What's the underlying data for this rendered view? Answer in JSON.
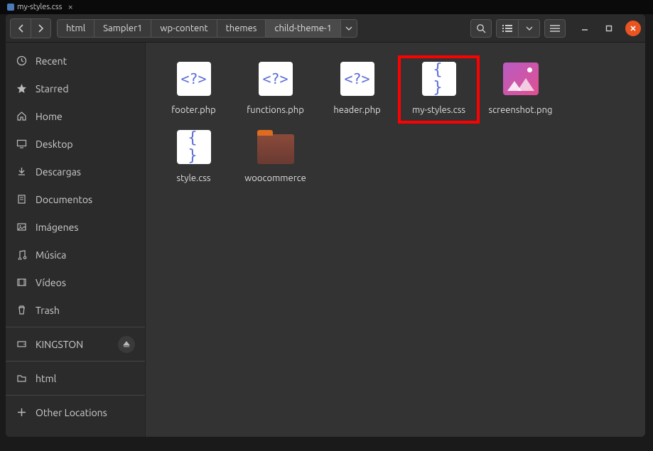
{
  "tab": {
    "title": "my-styles.css"
  },
  "breadcrumb": [
    "html",
    "Sampler1",
    "wp-content",
    "themes",
    "child-theme-1"
  ],
  "sidebar": {
    "recent": "Recent",
    "starred": "Starred",
    "home": "Home",
    "desktop": "Desktop",
    "downloads": "Descargas",
    "documents": "Documentos",
    "pictures": "Imágenes",
    "music": "Música",
    "videos": "Vídeos",
    "trash": "Trash",
    "drive": "KINGSTON",
    "bookmark": "html",
    "other": "Other Locations"
  },
  "files": [
    {
      "name": "footer.php",
      "type": "php"
    },
    {
      "name": "functions.php",
      "type": "php"
    },
    {
      "name": "header.php",
      "type": "php"
    },
    {
      "name": "my-styles.css",
      "type": "css",
      "highlighted": true
    },
    {
      "name": "screenshot.png",
      "type": "img"
    },
    {
      "name": "style.css",
      "type": "css"
    },
    {
      "name": "woocommerce",
      "type": "folder"
    }
  ],
  "glyph": {
    "php": "<?>",
    "css": "{ }"
  }
}
